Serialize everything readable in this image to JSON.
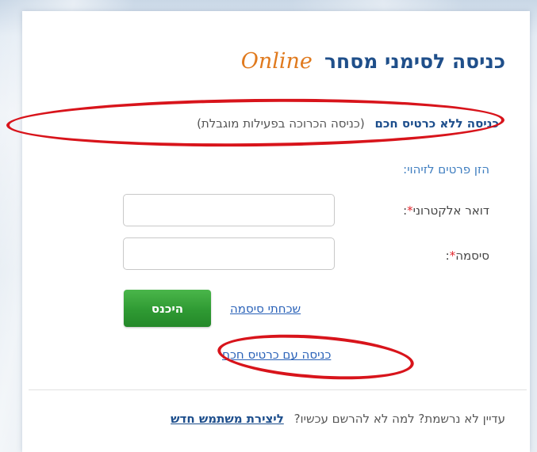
{
  "page": {
    "title": "כניסה לסימני מסחר",
    "title_suffix": "Online"
  },
  "no_smartcard": {
    "link_label": "כניסה ללא כרטיס חכם",
    "note": "(כניסה הכרוכה בפעילות מוגבלת)"
  },
  "form": {
    "ident_label": "הזן פרטים לזיהוי:",
    "email_label": "דואר אלקטרוני",
    "password_label": "סיסמה",
    "required_mark": "*",
    "colon": ":",
    "email_value": "",
    "password_value": "",
    "login_button": "היכנס",
    "forgot_password": "שכחתי סיסמה"
  },
  "smartcard": {
    "link_label": "כניסה עם כרטיס חכם"
  },
  "footer": {
    "text": "עדיין לא נרשמת? למה לא להרשם עכשיו?",
    "register_link": "ליצירת משתמש חדש"
  },
  "colors": {
    "title_blue": "#1f4f8a",
    "online_orange": "#e07a1e",
    "link_blue": "#2a62b8",
    "button_green": "#2f9a33",
    "annotation_red": "#d8141b",
    "required_red": "#e2262d"
  }
}
